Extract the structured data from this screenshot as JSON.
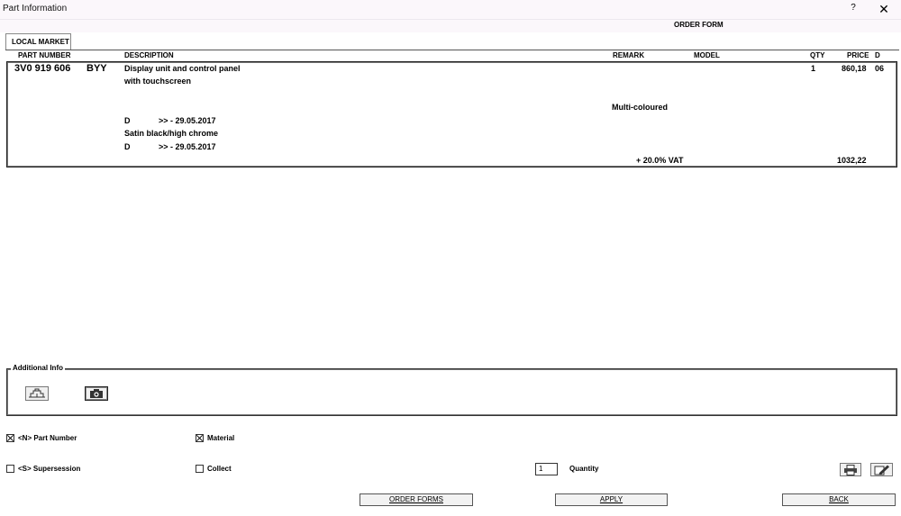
{
  "window": {
    "title": "Part Information",
    "help": "?",
    "close": "✕"
  },
  "form_title": "ORDER FORM",
  "tab": {
    "label": "LOCAL MARKET"
  },
  "columns": {
    "part_number": "PART NUMBER",
    "description": "DESCRIPTION",
    "remark": "REMARK",
    "model": "MODEL",
    "qty": "QTY",
    "price": "PRICE",
    "d": "D"
  },
  "part": {
    "number": "3V0 919 606",
    "suffix": "BYY",
    "desc1": "Display unit and control panel",
    "desc2": "with touchscreen",
    "remark": "Multi-coloured",
    "qty": "1",
    "price": "860,18",
    "d": "06",
    "line1_code": "D",
    "line1_date": ">> - 29.05.2017",
    "variant": "Satin black/high chrome",
    "line2_code": "D",
    "line2_date": ">> - 29.05.2017",
    "vat_label": "+ 20.0% VAT",
    "vat_price": "1032,22"
  },
  "additional_info": {
    "legend": "Additional Info",
    "icons": [
      "part-diagram-icon",
      "camera-icon"
    ]
  },
  "options": {
    "part_number": {
      "label": "<N> Part Number",
      "checked": true
    },
    "material": {
      "label": "Material",
      "checked": true
    },
    "supersession": {
      "label": "<S> Supersession",
      "checked": false
    },
    "collect": {
      "label": "Collect",
      "checked": false
    }
  },
  "quantity": {
    "value": "1",
    "label": "Quantity"
  },
  "buttons": {
    "order_forms": "ORDER FORMS",
    "apply": "APPLY",
    "back": "BACK"
  },
  "toolbar_icons": [
    "printer-icon",
    "edit-icon"
  ]
}
